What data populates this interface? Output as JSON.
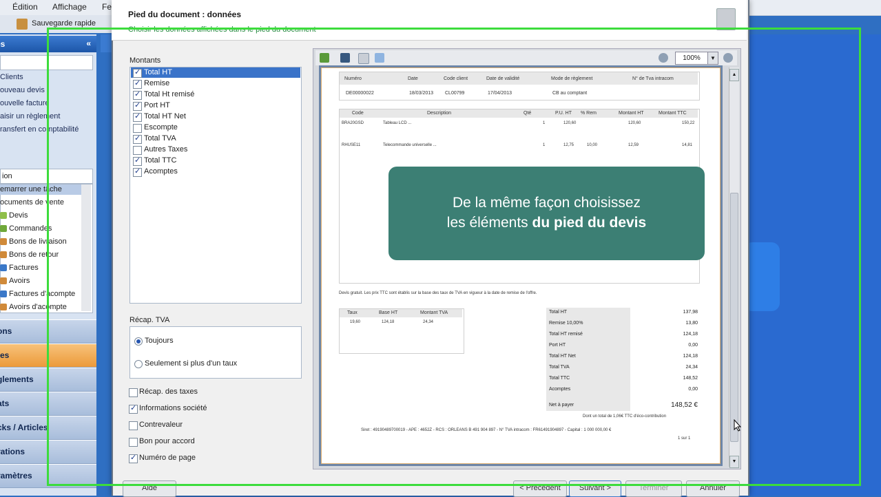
{
  "menubar": {
    "items": [
      "Édition",
      "Affichage",
      "Fe"
    ]
  },
  "toolbar": {
    "save_label": "Sauvegarde rapide"
  },
  "leftpane": {
    "header": "es",
    "collapse_glyph": "«",
    "tasks": [
      "Clients",
      "ouveau devis",
      "ouvelle facture",
      "aisir un règlement",
      "ransfert en comptabilité"
    ],
    "section2_label": "ion",
    "tree": [
      "emarrer une tâche",
      "ocuments de vente",
      "Devis",
      "Commandes",
      "Bons de livraison",
      "Bons de retour",
      "Factures",
      "Avoirs",
      "Factures d'acompte",
      "Avoirs d'acompte"
    ],
    "nav": [
      "ons",
      "tes",
      "glements",
      "ats",
      "cks / Articles",
      "rations",
      "ramètres"
    ]
  },
  "dialog": {
    "title": "Pied du document : données",
    "subtitle": "Choisir les données affichées dans le pied du document",
    "montants": {
      "label": "Montants",
      "items": [
        {
          "label": "Total HT",
          "checked": true
        },
        {
          "label": "Remise",
          "checked": true
        },
        {
          "label": "Total Ht remisé",
          "checked": true
        },
        {
          "label": "Port HT",
          "checked": true
        },
        {
          "label": "Total HT Net",
          "checked": true
        },
        {
          "label": "Escompte",
          "checked": false
        },
        {
          "label": "Total TVA",
          "checked": true
        },
        {
          "label": "Autres Taxes",
          "checked": false
        },
        {
          "label": "Total TTC",
          "checked": true
        },
        {
          "label": "Acomptes",
          "checked": true
        }
      ]
    },
    "recap": {
      "label": "Récap. TVA",
      "options": [
        {
          "label": "Toujours",
          "selected": true
        },
        {
          "label": "Seulement si plus d'un taux",
          "selected": false
        }
      ]
    },
    "options": [
      {
        "label": "Récap. des taxes",
        "checked": false
      },
      {
        "label": "Informations société",
        "checked": true
      },
      {
        "label": "Contrevaleur",
        "checked": false
      },
      {
        "label": "Bon pour accord",
        "checked": false
      },
      {
        "label": "Numéro de page",
        "checked": true
      }
    ],
    "buttons": [
      "Aide",
      "< Précédent",
      "Suivant >",
      "Terminer",
      "Annuler"
    ]
  },
  "preview": {
    "zoom": "100%",
    "header_cols": [
      "Numéro",
      "Date",
      "Code client",
      "Date de validité",
      "Mode de règlement",
      "N° de Tva intracom"
    ],
    "header_vals": [
      "DE00000022",
      "18/03/2013",
      "CL00799",
      "17/04/2013",
      "CB au comptant",
      ""
    ],
    "line_cols": [
      "Code",
      "Description",
      "Qté",
      "P.U. HT",
      "% Rem",
      "Montant HT",
      "Montant TTC"
    ],
    "lines": [
      {
        "code": "BRA20GSD",
        "desc": "Tableau LCD ...",
        "qte": "1",
        "pu": "120,60",
        "rem": "",
        "mht": "120,60",
        "mttc": "150,22"
      },
      {
        "code": "RHUSE11",
        "desc": "Telecommande universelle ...",
        "qte": "1",
        "pu": "12,75",
        "rem": "10,00",
        "mht": "12,59",
        "mttc": "14,81"
      }
    ],
    "legal_note": "Devis gratuit. Les prix TTC sont établis sur la base des taux de TVA en vigueur à la date de remise de l'offre.",
    "tva_cols": [
      "Taux",
      "Base HT",
      "Montant TVA"
    ],
    "tva_vals": [
      "19,60",
      "124,18",
      "24,34"
    ],
    "totals": [
      {
        "label": "Total HT",
        "value": "137,98"
      },
      {
        "label": "Remise 10,00%",
        "value": "13,80"
      },
      {
        "label": "Total HT remisé",
        "value": "124,18"
      },
      {
        "label": "Port HT",
        "value": "0,00"
      },
      {
        "label": "Total HT Net",
        "value": "124,18"
      },
      {
        "label": "Total TVA",
        "value": "24,34"
      },
      {
        "label": "Total TTC",
        "value": "148,52"
      },
      {
        "label": "Acomptes",
        "value": "0,00"
      }
    ],
    "net_label": "Net à payer",
    "net_value": "148,52 €",
    "eco_note": "Dont un total de 1,06€ TTC d'éco-contribution",
    "footer_note": "Siret : 49190489700019 - APE : 4652Z - RCS : ORLEANS B 491 904 897 - N° TVA intracom : FR61491904897 - Capital : 1 000 000,00 €",
    "page_num": "1 sur 1"
  },
  "banner": {
    "line1": "De la même façon choisissez",
    "line2_prefix": "les éléments ",
    "line2_bold": "du pied du devis"
  }
}
